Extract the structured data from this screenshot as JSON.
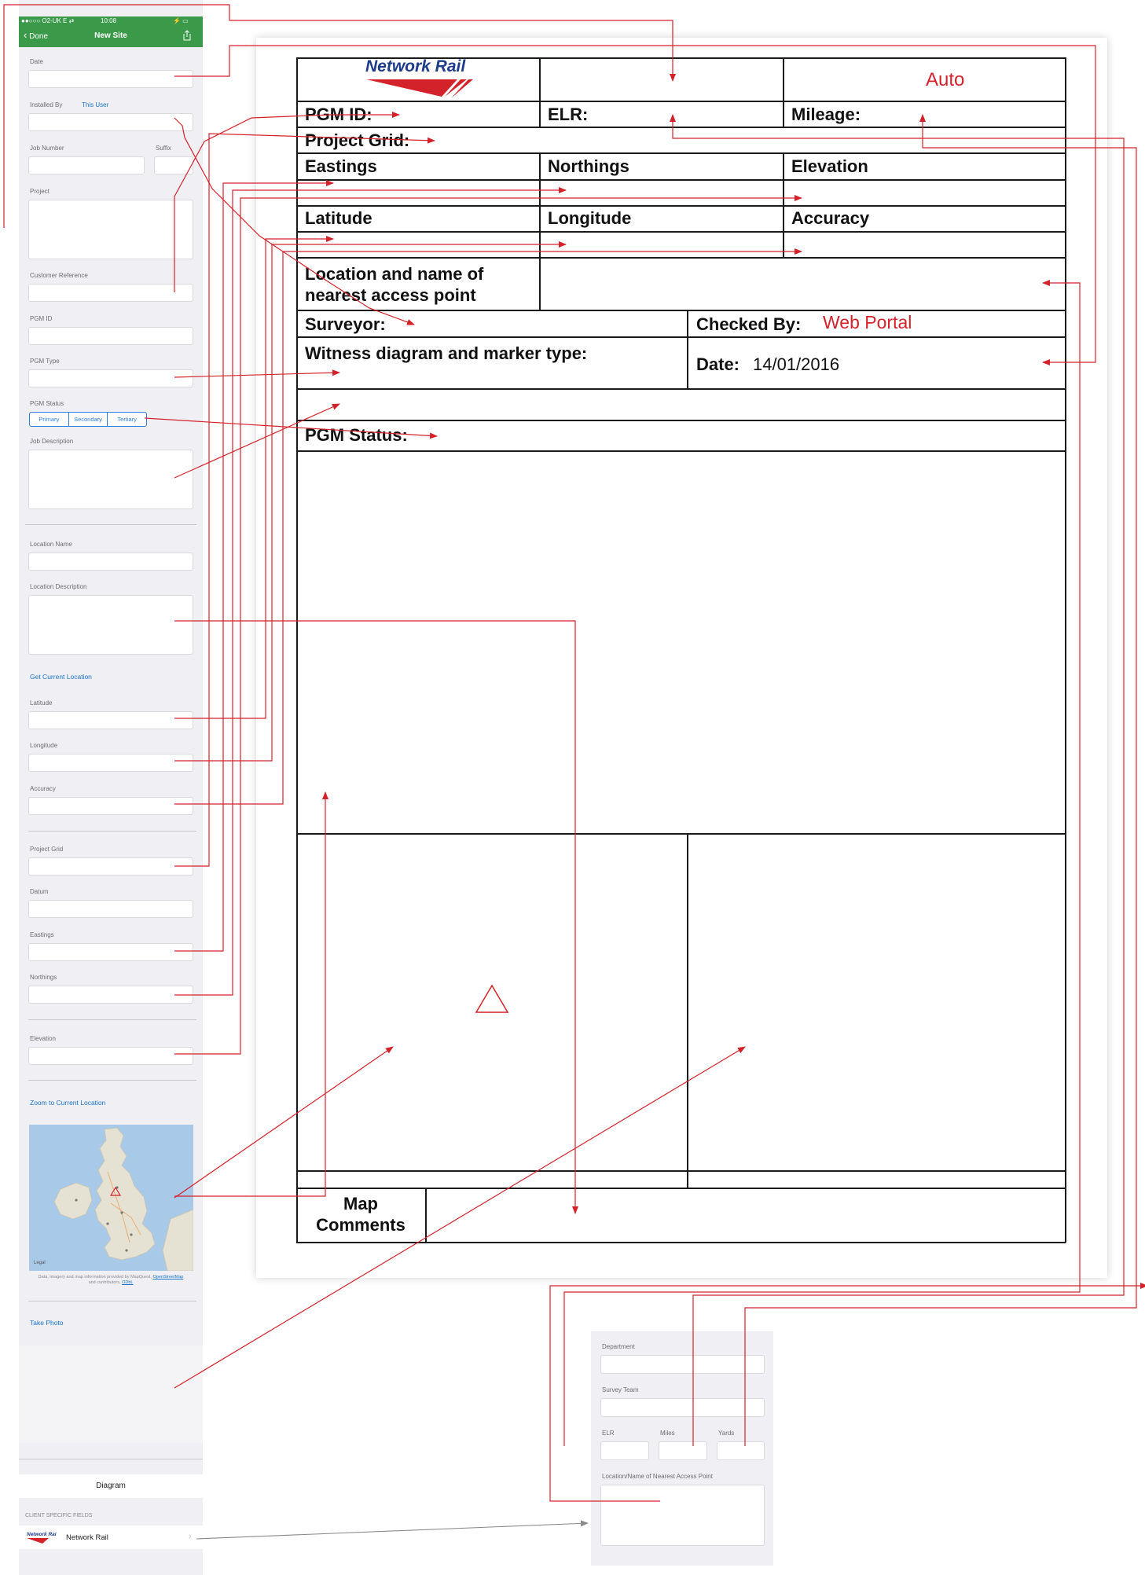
{
  "phone": {
    "status": {
      "carrier": "●●○○○ O2-UK  E ⇄",
      "time": "10:08",
      "battery": "⚡ ▭"
    },
    "nav": {
      "back": "Done",
      "title": "New Site"
    },
    "labels": {
      "date": "Date",
      "installed_by": "Installed By",
      "installed_by_value": "This User",
      "job_number": "Job Number",
      "suffix": "Suffix",
      "project": "Project",
      "customer_reference": "Customer Reference",
      "pgm_id": "PGM ID",
      "pgm_type": "PGM Type",
      "pgm_status": "PGM Status",
      "job_description": "Job Description",
      "location_name": "Location Name",
      "location_description": "Location Description",
      "latitude": "Latitude",
      "longitude": "Longitude",
      "accuracy": "Accuracy",
      "project_grid": "Project Grid",
      "datum": "Datum",
      "eastings": "Eastings",
      "northings": "Northings",
      "elevation": "Elevation"
    },
    "pgm_status_options": [
      "Primary",
      "Secondary",
      "Tertiary"
    ],
    "links": {
      "get_location": "Get Current Location",
      "zoom": "Zoom to Current Location",
      "take_photo": "Take Photo"
    },
    "map": {
      "legal": "Legal",
      "caption_1": "Data, imagery and map information provided by MapQuest,",
      "caption_link_1": "OpenStreetMap",
      "caption_2": "and contributors,",
      "caption_link_2": "ODbL"
    },
    "diagram": "Diagram",
    "client_header": "CLIENT SPECIFIC FIELDS",
    "client_row": "Network Rail"
  },
  "sheet": {
    "logo_text": "Network Rail",
    "auto": "Auto",
    "pgm_id": "PGM ID:",
    "elr": "ELR:",
    "mileage": "Mileage:",
    "project_grid": "Project Grid:",
    "eastings": "Eastings",
    "northings": "Northings",
    "elevation": "Elevation",
    "latitude": "Latitude",
    "longitude": "Longitude",
    "accuracy": "Accuracy",
    "location_1": "Location and name of",
    "location_2": "nearest access point",
    "surveyor": "Surveyor:",
    "checked_by": "Checked By:",
    "checked_by_value": "Web Portal",
    "witness": "Witness diagram and marker type:",
    "date_label": "Date:",
    "date_value": "14/01/2016",
    "pgm_status": "PGM Status:",
    "map_1": "Map",
    "map_2": "Comments"
  },
  "client_panel": {
    "department": "Department",
    "survey_team": "Survey Team",
    "elr": "ELR",
    "miles": "Miles",
    "yards": "Yards",
    "location": "Location/Name of Nearest Access Point"
  },
  "colors": {
    "nav_green": "#3a9a4a",
    "link_blue": "#1a73c9",
    "arrow_red": "#d4222a",
    "logo_blue": "#1e3c8c"
  }
}
